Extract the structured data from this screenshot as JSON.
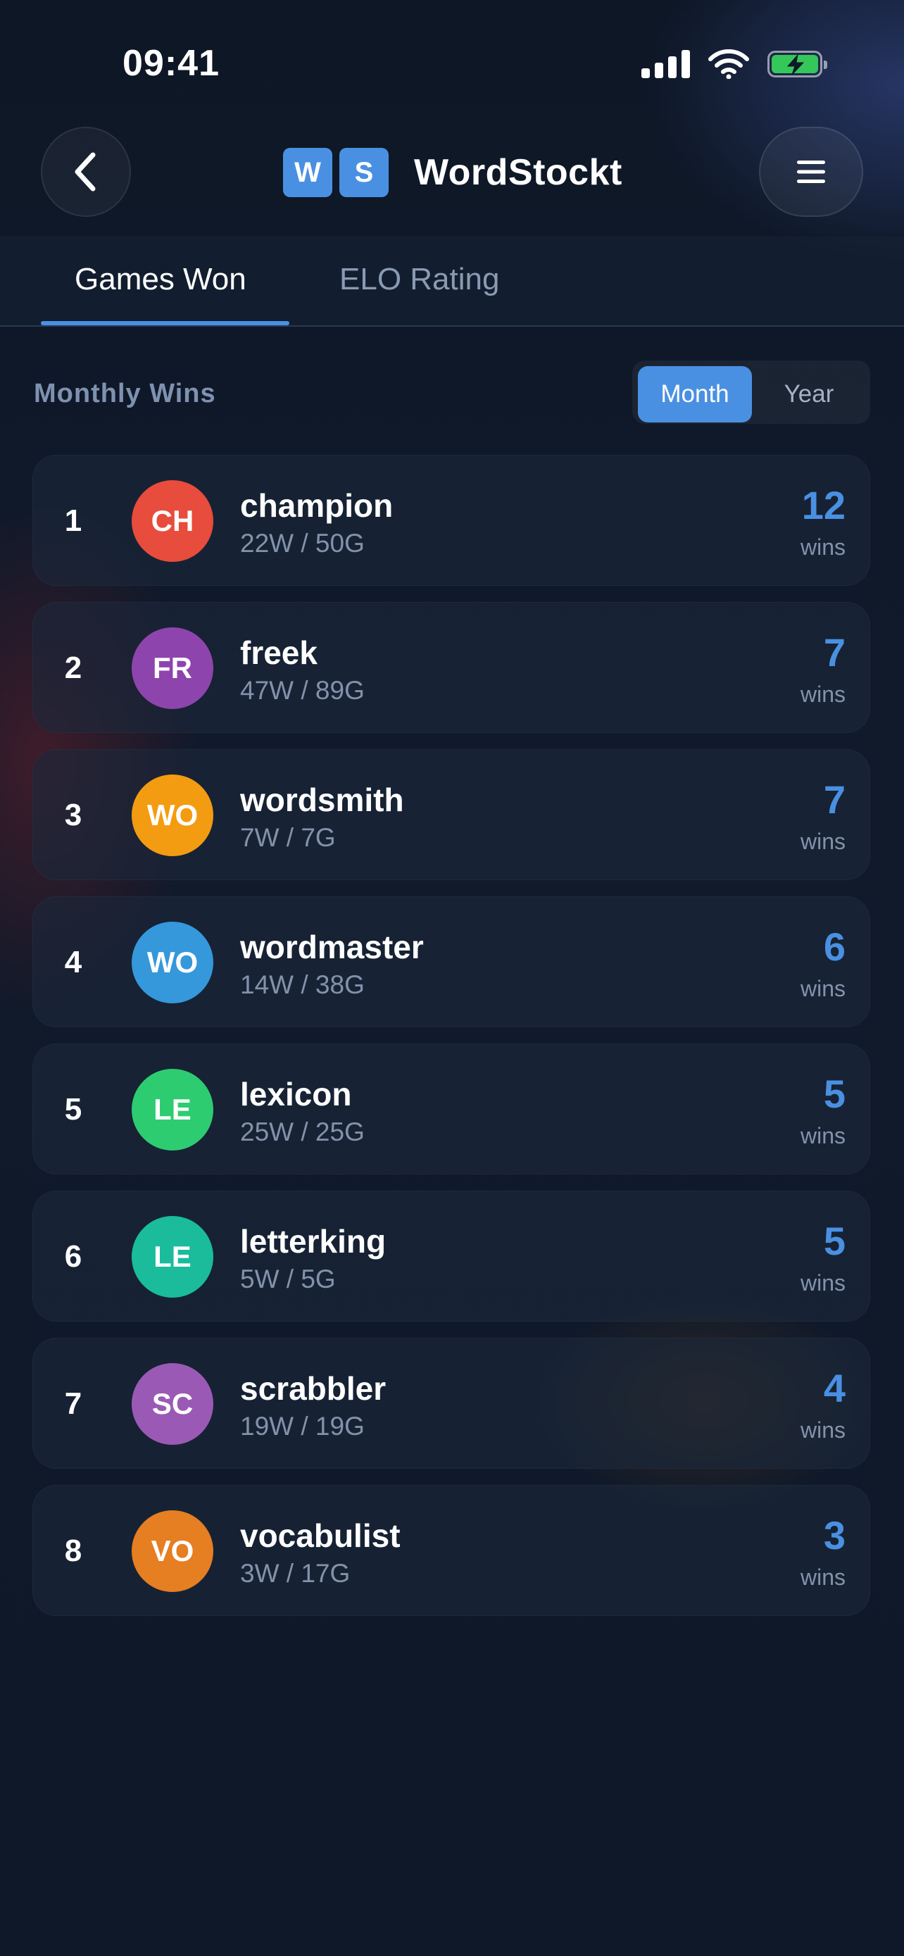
{
  "status_bar": {
    "time": "09:41",
    "icons": [
      "signal-icon",
      "wifi-icon",
      "battery-charging-icon"
    ],
    "battery_color": "#35c759"
  },
  "header": {
    "back_icon": "chevron-left-icon",
    "logo_tiles": [
      "W",
      "S"
    ],
    "app_name": "WordStockt",
    "menu_icon": "hamburger-menu-icon",
    "tile_color": "#4a90e2"
  },
  "tabs": [
    {
      "label": "Games Won",
      "active": true
    },
    {
      "label": "ELO Rating",
      "active": false
    }
  ],
  "section": {
    "title": "Monthly Wins",
    "period_options": [
      {
        "label": "Month",
        "selected": true
      },
      {
        "label": "Year",
        "selected": false
      }
    ]
  },
  "leaderboard": [
    {
      "rank": "1",
      "initials": "CH",
      "name": "champion",
      "record": "22W / 50G",
      "wins": "12",
      "wins_label": "wins",
      "color": "#e74c3c"
    },
    {
      "rank": "2",
      "initials": "FR",
      "name": "freek",
      "record": "47W / 89G",
      "wins": "7",
      "wins_label": "wins",
      "color": "#8e44ad"
    },
    {
      "rank": "3",
      "initials": "WO",
      "name": "wordsmith",
      "record": "7W / 7G",
      "wins": "7",
      "wins_label": "wins",
      "color": "#f39c12"
    },
    {
      "rank": "4",
      "initials": "WO",
      "name": "wordmaster",
      "record": "14W / 38G",
      "wins": "6",
      "wins_label": "wins",
      "color": "#3498db"
    },
    {
      "rank": "5",
      "initials": "LE",
      "name": "lexicon",
      "record": "25W / 25G",
      "wins": "5",
      "wins_label": "wins",
      "color": "#2ecc71"
    },
    {
      "rank": "6",
      "initials": "LE",
      "name": "letterking",
      "record": "5W / 5G",
      "wins": "5",
      "wins_label": "wins",
      "color": "#1abc9c"
    },
    {
      "rank": "7",
      "initials": "SC",
      "name": "scrabbler",
      "record": "19W / 19G",
      "wins": "4",
      "wins_label": "wins",
      "color": "#9b59b6"
    },
    {
      "rank": "8",
      "initials": "VO",
      "name": "vocabulist",
      "record": "3W / 17G",
      "wins": "3",
      "wins_label": "wins",
      "color": "#e67e22"
    }
  ],
  "accent_color": "#4a90e2"
}
